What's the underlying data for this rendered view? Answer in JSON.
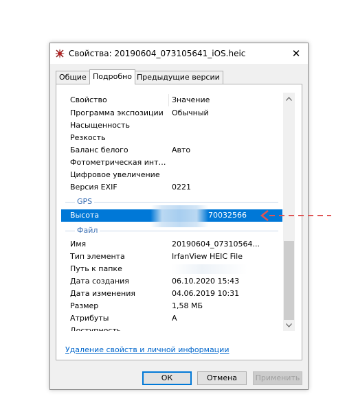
{
  "window": {
    "title": "Свойства: 20190604_073105641_iOS.heic",
    "close_glyph": "✕"
  },
  "tabs": [
    {
      "label": "Общие"
    },
    {
      "label": "Подробно"
    },
    {
      "label": "Предыдущие версии"
    }
  ],
  "properties": {
    "header": {
      "name": "Свойство",
      "value": "Значение"
    },
    "rows_top": [
      {
        "name": "Программа экспозиции",
        "value": "Обычный"
      },
      {
        "name": "Насыщенность",
        "value": ""
      },
      {
        "name": "Резкость",
        "value": ""
      },
      {
        "name": "Баланс белого",
        "value": "Авто"
      },
      {
        "name": "Фотометрическая интер...",
        "value": ""
      },
      {
        "name": "Цифровое увеличение",
        "value": ""
      },
      {
        "name": "Версия EXIF",
        "value": "0221"
      }
    ],
    "group_gps": "GPS",
    "selected_row": {
      "name": "Высота",
      "value": "70032566"
    },
    "group_file": "Файл",
    "rows_file": [
      {
        "name": "Имя",
        "value": "20190604_07310564..."
      },
      {
        "name": "Тип элемента",
        "value": "IrfanView HEIC File"
      },
      {
        "name": "Путь к папке",
        "value": ""
      },
      {
        "name": "Дата создания",
        "value": "06.10.2020 15:43"
      },
      {
        "name": "Дата изменения",
        "value": "04.06.2019 10:31"
      },
      {
        "name": "Размер",
        "value": "1,58 МБ"
      },
      {
        "name": "Атрибуты",
        "value": "A"
      },
      {
        "name": "Доступность",
        "value": ""
      }
    ]
  },
  "remove_link": "Удаление свойств и личной информации",
  "buttons": {
    "ok": "ОК",
    "cancel": "Отмена",
    "apply": "Применить"
  },
  "colors": {
    "selection": "#0078d7",
    "link": "#0066cc",
    "group_label": "#3b6fb3",
    "annotation_arrow": "#e05555"
  }
}
